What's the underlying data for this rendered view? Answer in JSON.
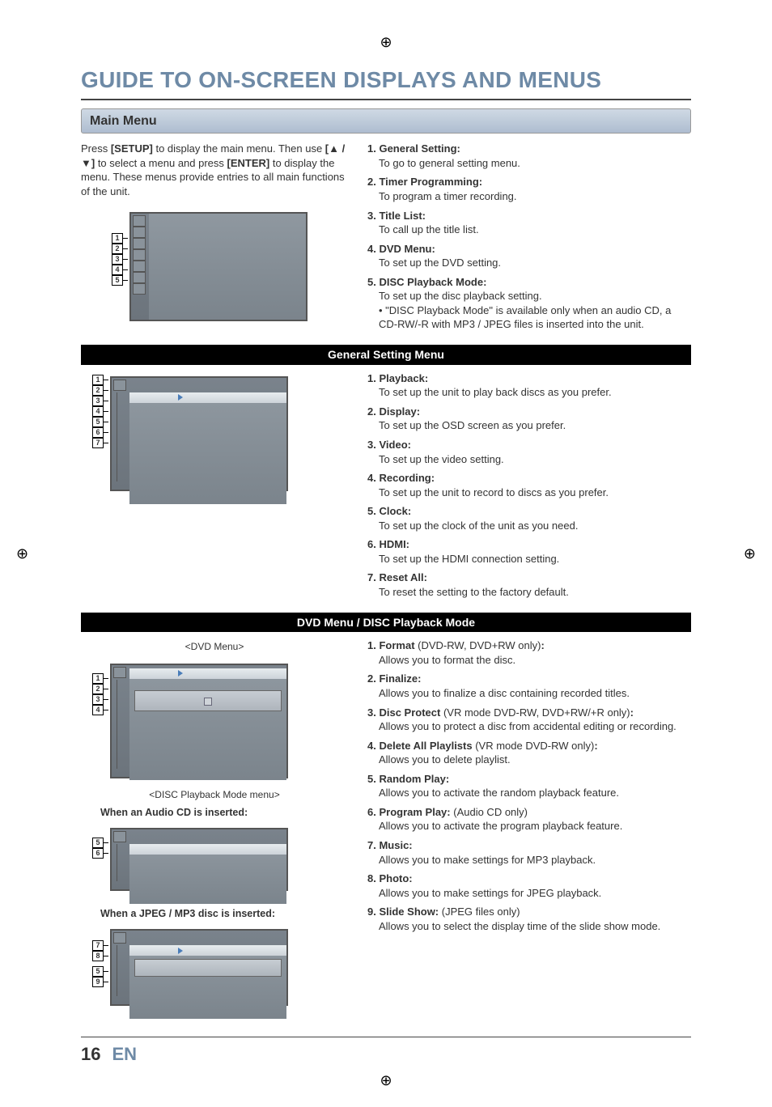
{
  "title": "GUIDE TO ON-SCREEN DISPLAYS AND MENUS",
  "section_main": "Main Menu",
  "intro_parts": {
    "p1a": "Press ",
    "p1b": "[SETUP]",
    "p1c": " to display the main menu. Then use ",
    "p1d": "[▲ / ▼]",
    "p1e": " to select a menu and press ",
    "p1f": "[ENTER]",
    "p1g": " to display the menu. These menus provide entries to all main functions of the unit."
  },
  "main_list": [
    {
      "n": "1.",
      "head": "General Setting:",
      "desc": "To go to general setting menu."
    },
    {
      "n": "2.",
      "head": "Timer Programming:",
      "desc": "To program a timer recording."
    },
    {
      "n": "3.",
      "head": "Title List:",
      "desc": "To call up the title list."
    },
    {
      "n": "4.",
      "head": "DVD Menu:",
      "desc": "To set up the DVD setting."
    },
    {
      "n": "5.",
      "head": "DISC Playback Mode:",
      "desc": "To set up the disc playback setting.",
      "note": "\"DISC Playback Mode\" is available only when an audio CD, a CD-RW/-R with MP3 / JPEG files is inserted into the unit."
    }
  ],
  "black_bar_gs": "General Setting Menu",
  "gs_list": [
    {
      "n": "1.",
      "head": "Playback:",
      "desc": "To set up the unit to play back discs as you prefer."
    },
    {
      "n": "2.",
      "head": "Display:",
      "desc": "To set up the OSD screen as you prefer."
    },
    {
      "n": "3.",
      "head": "Video:",
      "desc": "To set up the video setting."
    },
    {
      "n": "4.",
      "head": "Recording:",
      "desc": "To set up the unit to record to discs as you prefer."
    },
    {
      "n": "5.",
      "head": "Clock:",
      "desc": "To set up the clock of the unit as you need."
    },
    {
      "n": "6.",
      "head": "HDMI:",
      "desc": "To set up the HDMI connection setting."
    },
    {
      "n": "7.",
      "head": "Reset All:",
      "desc": "To reset the setting to the factory default."
    }
  ],
  "black_bar_dvd": "DVD Menu / DISC Playback Mode",
  "caption_dvdmenu": "<DVD Menu>",
  "caption_discpb": "<DISC Playback Mode menu>",
  "subhead_audiocd": "When an Audio CD is inserted:",
  "subhead_jpegmp3": "When a JPEG / MP3 disc is inserted:",
  "dvd_list": [
    {
      "n": "1.",
      "head": "Format",
      "paren": " (DVD-RW, DVD+RW only)",
      "colon": ":",
      "desc": "Allows you to format the disc."
    },
    {
      "n": "2.",
      "head": "Finalize:",
      "desc": "Allows you to finalize a disc containing recorded titles."
    },
    {
      "n": "3.",
      "head": "Disc Protect",
      "paren": " (VR mode DVD-RW, DVD+RW/+R only)",
      "colon": ":",
      "desc": "Allows you to protect a disc from accidental editing or recording."
    },
    {
      "n": "4.",
      "head": "Delete All Playlists",
      "paren": " (VR mode DVD-RW only)",
      "colon": ":",
      "desc": "Allows you to delete playlist."
    },
    {
      "n": "5.",
      "head": "Random Play:",
      "desc": "Allows you to activate the random playback feature."
    },
    {
      "n": "6.",
      "head": "Program Play:",
      "paren": " (Audio CD only)",
      "desc": "Allows you to activate the program playback feature."
    },
    {
      "n": "7.",
      "head": "Music:",
      "desc": "Allows you to make settings for MP3 playback."
    },
    {
      "n": "8.",
      "head": "Photo:",
      "desc": "Allows you to make settings for JPEG playback."
    },
    {
      "n": "9.",
      "head": "Slide Show:",
      "paren": " (JPEG files only)",
      "desc": "Allows you to select the display time of the slide show mode."
    }
  ],
  "callouts_main": [
    "1",
    "2",
    "3",
    "4",
    "5"
  ],
  "callouts_gs": [
    "1",
    "2",
    "3",
    "4",
    "5",
    "6",
    "7"
  ],
  "callouts_dvd": [
    "1",
    "2",
    "3",
    "4"
  ],
  "callouts_cd": [
    "5",
    "6"
  ],
  "callouts_jm": [
    "7",
    "8",
    "5",
    "9"
  ],
  "footer": {
    "page": "16",
    "lang": "EN"
  }
}
